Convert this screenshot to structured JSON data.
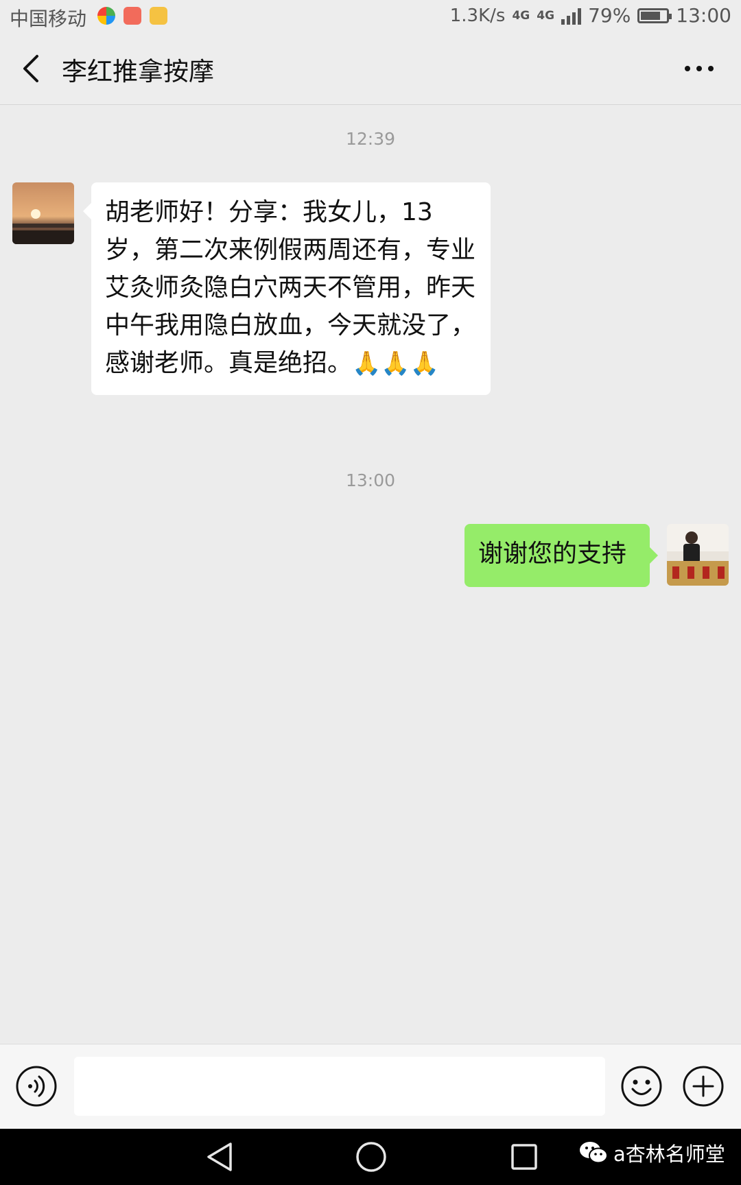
{
  "status_bar": {
    "carrier": "中国移动",
    "net_speed": "1.3K/s",
    "network_badge_1": "4G",
    "network_badge_2": "4G",
    "battery": "79%",
    "battery_level": 0.79,
    "time": "13:00"
  },
  "header": {
    "title": "李红推拿按摩"
  },
  "messages": [
    {
      "timestamp": "12:39",
      "direction": "incoming",
      "text": "胡老师好！分享：我女儿，13岁，第二次来例假两周还有，专业艾灸师灸隐白穴两天不管用，昨天中午我用隐白放血，今天就没了，感谢老师。真是绝招。",
      "emoji": "🙏🙏🙏"
    },
    {
      "timestamp": "13:00",
      "direction": "outgoing",
      "text": "谢谢您的支持"
    }
  ],
  "input": {
    "placeholder": ""
  },
  "watermark": {
    "text": "a杏林名师堂"
  },
  "colors": {
    "outgoing_bubble": "#95ec69",
    "incoming_bubble": "#ffffff",
    "background": "#ececec"
  }
}
